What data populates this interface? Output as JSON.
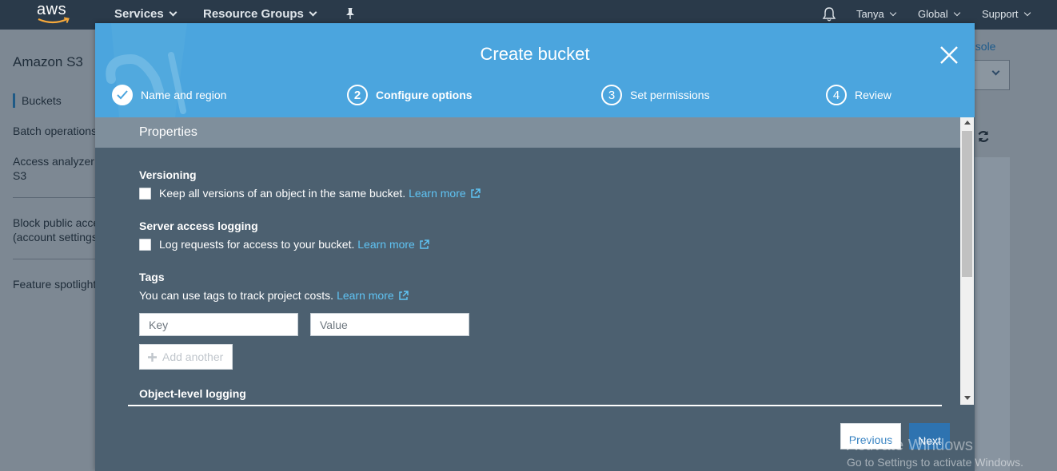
{
  "topnav": {
    "logo_text": "aws",
    "services": "Services",
    "resource_groups": "Resource Groups",
    "user": "Tanya",
    "region": "Global",
    "support": "Support"
  },
  "background": {
    "service_title": "Amazon S3",
    "sidebar_items": [
      "Buckets",
      "Batch operations",
      "Access analyzer for",
      "S3",
      "Block public access",
      "(account settings)",
      "Feature spotlight"
    ],
    "console_link": "nsole"
  },
  "modal": {
    "title": "Create bucket",
    "steps": [
      {
        "number": "1",
        "label": "Name and region",
        "state": "done"
      },
      {
        "number": "2",
        "label": "Configure options",
        "state": "active"
      },
      {
        "number": "3",
        "label": "Set permissions",
        "state": "pending"
      },
      {
        "number": "4",
        "label": "Review",
        "state": "pending"
      }
    ],
    "properties_title": "Properties",
    "versioning": {
      "label": "Versioning",
      "checkbox_text": "Keep all versions of an object in the same bucket.",
      "checked": false,
      "learn_more": "Learn more"
    },
    "logging": {
      "label": "Server access logging",
      "checkbox_text": "Log requests for access to your bucket.",
      "checked": false,
      "learn_more": "Learn more"
    },
    "tags": {
      "label": "Tags",
      "description": "You can use tags to track project costs.",
      "learn_more": "Learn more",
      "key_placeholder": "Key",
      "value_placeholder": "Value",
      "add_another": "Add another"
    },
    "object_logging_label": "Object-level logging",
    "previous_button": "Previous",
    "next_button": "Next"
  },
  "watermark": {
    "line1": "Activate Windows",
    "line2": "Go to Settings to activate Windows."
  },
  "colors": {
    "header_blue": "#4ba5de",
    "body_slate": "#4c6070",
    "link": "#5fc3f3",
    "primary_button": "#2e73b0"
  }
}
